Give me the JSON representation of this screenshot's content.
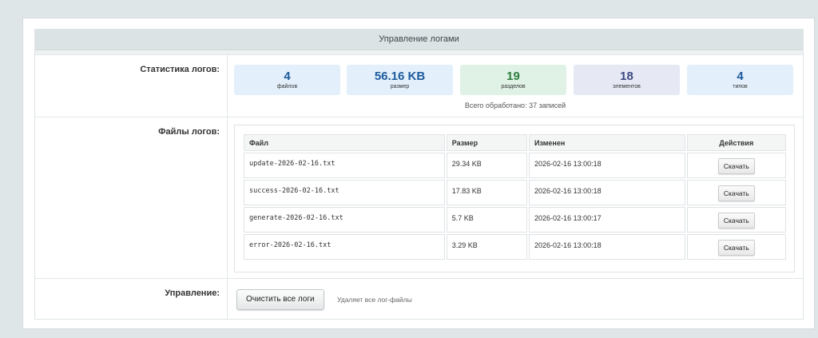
{
  "panel": {
    "title": "Управление логами"
  },
  "stats": {
    "label": "Статистика логов:",
    "cards": [
      {
        "value": "4",
        "label": "файлов",
        "bg": "#e3f0fb",
        "color": "#1e5a9c"
      },
      {
        "value": "56.16 KB",
        "label": "размер",
        "bg": "#e3f0fb",
        "color": "#1e5a9c"
      },
      {
        "value": "19",
        "label": "разделов",
        "bg": "#e0f1e6",
        "color": "#2e7d3d"
      },
      {
        "value": "18",
        "label": "элементов",
        "bg": "#e6e8f4",
        "color": "#3c4a80"
      },
      {
        "value": "4",
        "label": "типов",
        "bg": "#e3f0fb",
        "color": "#1e5a9c"
      }
    ],
    "summary_prefix": "Всего обработано:",
    "summary_value": "37 записей"
  },
  "files": {
    "label": "Файлы логов:",
    "columns": [
      "Файл",
      "Размер",
      "Изменен",
      "Действия"
    ],
    "rows": [
      {
        "name": "update-2026-02-16.txt",
        "size": "29.34 KB",
        "modified": "2026-02-16 13:00:18",
        "action": "Скачать"
      },
      {
        "name": "success-2026-02-16.txt",
        "size": "17.83 KB",
        "modified": "2026-02-16 13:00:18",
        "action": "Скачать"
      },
      {
        "name": "generate-2026-02-16.txt",
        "size": "5.7 KB",
        "modified": "2026-02-16 13:00:17",
        "action": "Скачать"
      },
      {
        "name": "error-2026-02-16.txt",
        "size": "3.29 KB",
        "modified": "2026-02-16 13:00:18",
        "action": "Скачать"
      }
    ]
  },
  "management": {
    "label": "Управление:",
    "clear_button": "Очистить все логи",
    "note": "Удаляет все лог-файлы"
  }
}
